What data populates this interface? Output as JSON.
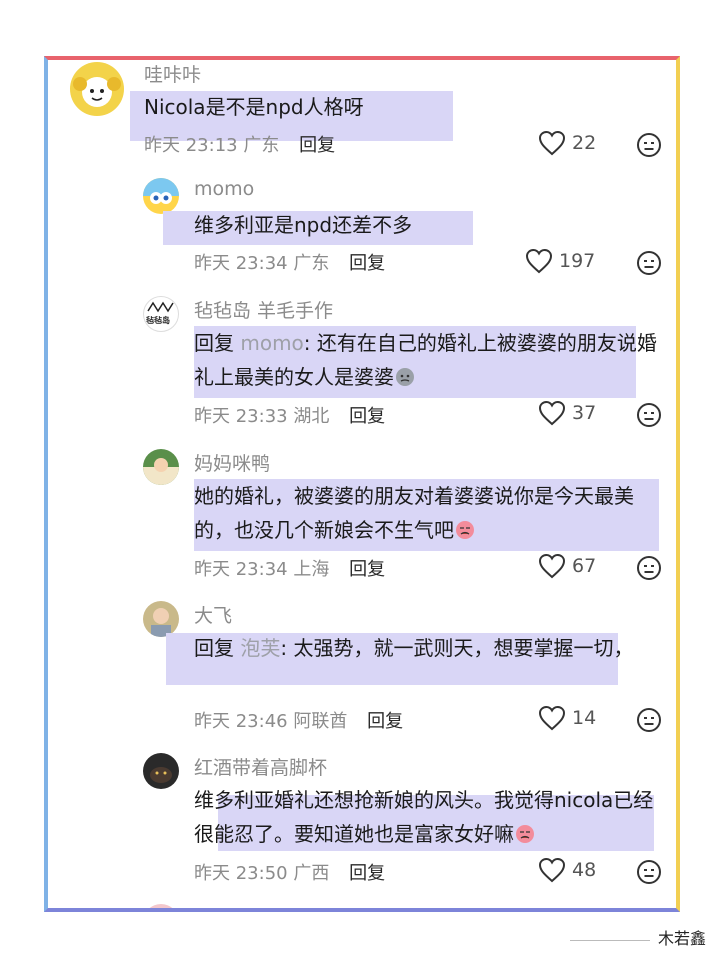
{
  "comments": [
    {
      "name": "哇咔咔",
      "text_pre": "Nicola是不是npd人格呀",
      "mention": "",
      "text_post": "",
      "time": "昨天 23:13",
      "location": "广东",
      "reply": "回复",
      "likes": "22"
    },
    {
      "name": "momo",
      "text_pre": "维多利亚是npd还差不多",
      "mention": "",
      "text_post": "",
      "time": "昨天 23:34",
      "location": "广东",
      "reply": "回复",
      "likes": "197"
    },
    {
      "name": "毡毡岛 羊毛手作",
      "text_pre": "回复 ",
      "mention": "momo",
      "text_post": ": 还有在自己的婚礼上被婆婆的朋友说婚礼上最美的女人是婆婆",
      "time": "昨天 23:33",
      "location": "湖北",
      "reply": "回复",
      "likes": "37"
    },
    {
      "name": "妈妈咪鸭",
      "text_pre": "她的婚礼，被婆婆的朋友对着婆婆说你是今天最美的，也没几个新娘会不生气吧",
      "mention": "",
      "text_post": "",
      "time": "昨天 23:34",
      "location": "上海",
      "reply": "回复",
      "likes": "67"
    },
    {
      "name": "大飞",
      "text_pre": "回复 ",
      "mention": "泡芙",
      "text_post": ": 太强势，就一武则天，想要掌握一切，",
      "time": "昨天 23:46",
      "location": "阿联酋",
      "reply": "回复",
      "likes": "14"
    },
    {
      "name": "红酒带着高脚杯",
      "text_pre": "维多利亚婚礼还想抢新娘的风头。我觉得nicola已经很能忍了。要知道她也是富家女好嘛",
      "mention": "",
      "text_post": "",
      "time": "昨天 23:50",
      "location": "广西",
      "reply": "回复",
      "likes": "48"
    }
  ],
  "avatar_logo_text": "毡毡岛",
  "signature": "木若鑫",
  "icons": {
    "like": "heart-outline-icon",
    "dislike": "meh-face-icon"
  }
}
